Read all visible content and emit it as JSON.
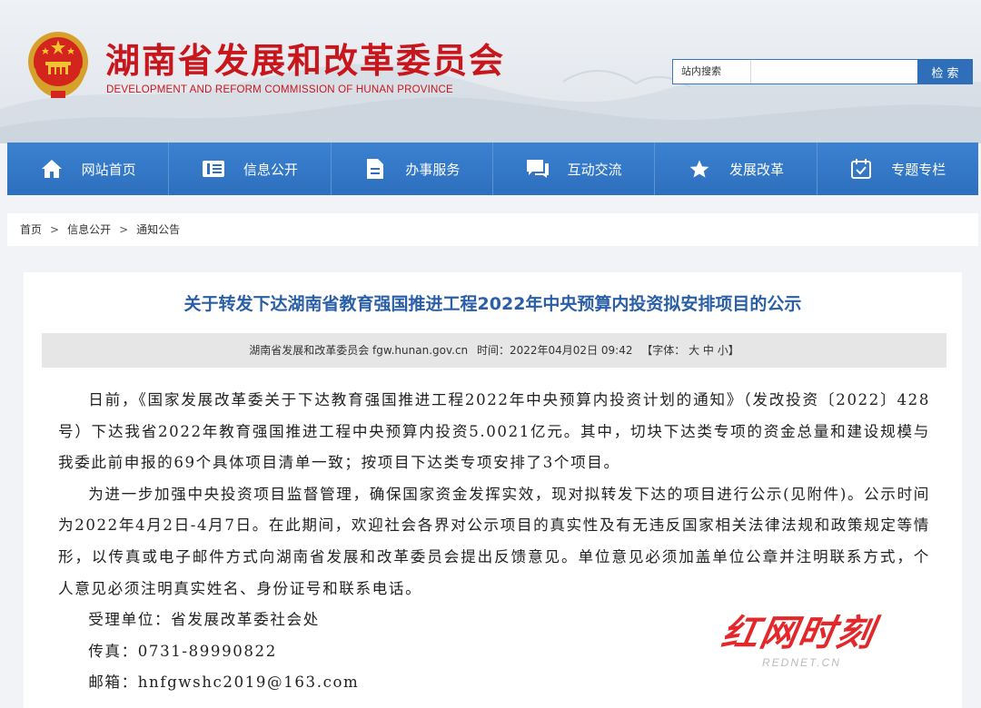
{
  "header": {
    "site_title": "湖南省发展和改革委员会",
    "site_subtitle": "DEVELOPMENT AND REFORM COMMISSION OF HUNAN PROVINCE",
    "emblem_icon": "national-emblem-icon"
  },
  "search": {
    "label": "站内搜索",
    "placeholder": "",
    "button_label": "检 索"
  },
  "nav": {
    "items": [
      {
        "label": "网站首页",
        "icon": "home-icon"
      },
      {
        "label": "信息公开",
        "icon": "book-icon"
      },
      {
        "label": "办事服务",
        "icon": "document-icon"
      },
      {
        "label": "互动交流",
        "icon": "chat-icon"
      },
      {
        "label": "发展改革",
        "icon": "star-icon"
      },
      {
        "label": "专题专栏",
        "icon": "calendar-check-icon"
      }
    ]
  },
  "breadcrumb": {
    "items": [
      "首页",
      "信息公开",
      "通知公告"
    ],
    "separator": ">"
  },
  "article": {
    "title": "关于转发下达湖南省教育强国推进工程2022年中央预算内投资拟安排项目的公示",
    "meta": {
      "source": "湖南省发展和改革委员会 fgw.hunan.gov.cn",
      "time": "时间：2022年04月02日 09:42",
      "font_size": "【字体： 大 中 小】"
    },
    "paragraphs": [
      "日前，《国家发展改革委关于下达教育强国推进工程2022年中央预算内投资计划的通知》（发改投资〔2022〕428号）下达我省2022年教育强国推进工程中央预算内投资5.0021亿元。其中，切块下达类专项的资金总量和建设规模与我委此前申报的69个具体项目清单一致；按项目下达类专项安排了3个项目。",
      "为进一步加强中央投资项目监督管理，确保国家资金发挥实效，现对拟转发下达的项目进行公示(见附件)。公示时间为2022年4月2日-4月7日。在此期间，欢迎社会各界对公示项目的真实性及有无违反国家相关法律法规和政策规定等情形，以传真或电子邮件方式向湖南省发展和改革委员会提出反馈意见。单位意见必须加盖单位公章并注明联系方式，个人意见必须注明真实姓名、身份证号和联系电话。",
      "受理单位：省发展改革委社会处",
      "传真：0731-89990822",
      "邮箱：hnfgwshc2019@163.com"
    ]
  },
  "watermark": {
    "main": "红网时刻",
    "sub": "REDNET.CN"
  },
  "colors": {
    "brand_red": "#c8161d",
    "nav_blue": "#2d6fbe",
    "title_blue": "#2a5fa8"
  }
}
